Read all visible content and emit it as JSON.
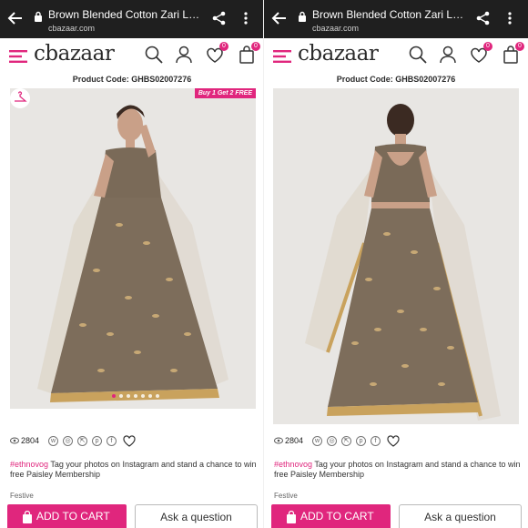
{
  "browser": {
    "title": "Brown Blended Cotton Zari Lehenga Choli",
    "host": "cbazaar.com"
  },
  "site": {
    "logo": "cbazaar",
    "wishlist_count": "0",
    "cart_count": "0"
  },
  "product": {
    "code_label": "Product Code: GHBS02007276",
    "offer_tag": "Buy 1 Get 2 FREE",
    "views": "2804",
    "hashtag": "#ethnovog",
    "tagline": " Tag your photos on Instagram and stand a chance to win free Paisley Membership",
    "category": "Festive"
  },
  "actions": {
    "add_to_cart": "ADD TO CART",
    "ask_question": "Ask a question"
  },
  "social_icons": [
    "whatsapp-icon",
    "instagram-icon",
    "share-icon",
    "pinterest-icon",
    "facebook-icon"
  ],
  "colors": {
    "brand_pink": "#e0267d",
    "browser_bar": "#1f1f1f",
    "lehenga_brown": "#7a6a58",
    "zari_gold": "#d4b37a"
  }
}
